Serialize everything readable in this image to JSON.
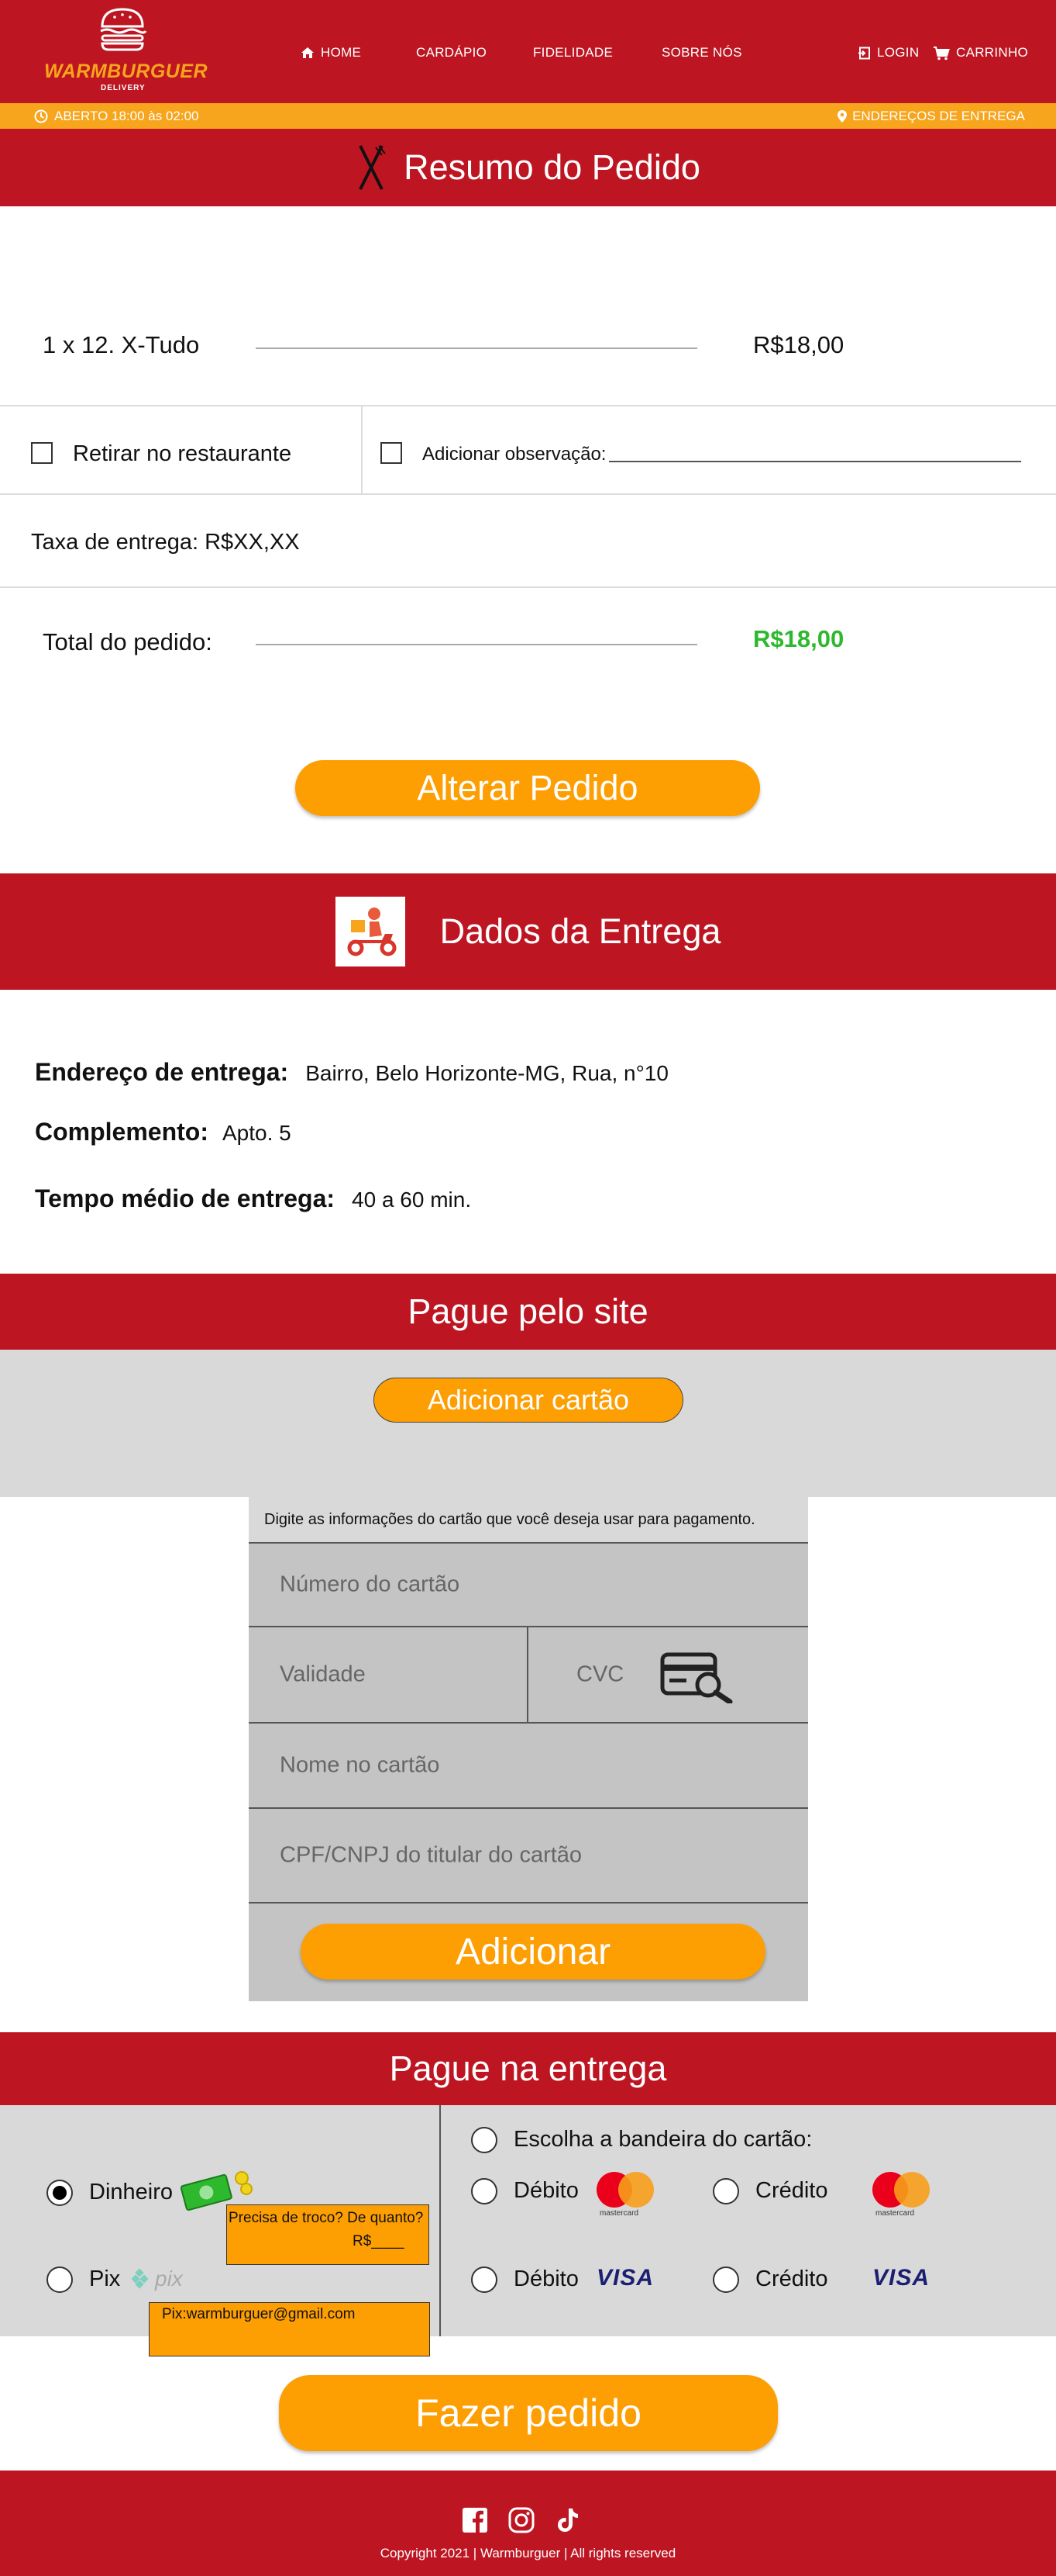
{
  "header": {
    "brand": "WARMBURGUER",
    "brand_sub": "DELIVERY",
    "nav": [
      {
        "label": "HOME",
        "icon": "home-icon"
      },
      {
        "label": "CARDÁPIO"
      },
      {
        "label": "FIDELIDADE"
      },
      {
        "label": "SOBRE NÓS"
      }
    ],
    "login": "LOGIN",
    "cart": "CARRINHO"
  },
  "status_bar": {
    "open_hours": "ABERTO 18:00 às 02:00",
    "delivery_addresses": "ENDEREÇOS DE ENTREGA"
  },
  "order_summary": {
    "title": "Resumo do Pedido",
    "item": "1 x 12. X-Tudo",
    "item_price": "R$18,00",
    "pickup_label": "Retirar no restaurante",
    "note_label": "Adicionar observação:",
    "delivery_fee": "Taxa de entrega: R$XX,XX",
    "total_label": "Total do pedido:",
    "total_value": "R$18,00",
    "change_order_button": "Alterar Pedido"
  },
  "delivery": {
    "title": "Dados da Entrega",
    "address_label": "Endereço de entrega:",
    "address_value": "Bairro, Belo Horizonte-MG, Rua, n°10",
    "complement_label": "Complemento:",
    "complement_value": "Apto. 5",
    "time_label": "Tempo médio de entrega:",
    "time_value": "40 a 60 min."
  },
  "pay_online": {
    "title": "Pague pelo site",
    "add_card_button": "Adicionar cartão",
    "card_form": {
      "instructions": "Digite as informações do cartão que você  deseja usar para pagamento.",
      "card_number_placeholder": "Número do cartão",
      "expiry_placeholder": "Validade",
      "cvc_placeholder": "CVC",
      "name_placeholder": "Nome no cartão",
      "document_placeholder": "CPF/CNPJ do titular do cartão",
      "submit_button": "Adicionar"
    }
  },
  "pay_on_delivery": {
    "title": "Pague na entrega",
    "cash_label": "Dinheiro",
    "change_question": "Precisa de troco? De quanto?",
    "change_amount": "R$____",
    "pix_label": "Pix",
    "pix_logo_text": "pix",
    "pix_key": "Pix:warmburguer@gmail.com",
    "card_brand_prompt": "Escolha a bandeira do cartão:",
    "debit_label": "Débito",
    "credit_label": "Crédito",
    "mastercard_text": "mastercard",
    "visa_text": "VISA",
    "place_order_button": "Fazer pedido"
  },
  "footer": {
    "social_icons": [
      "facebook-icon",
      "instagram-icon",
      "tiktok-icon"
    ],
    "copyright": "Copyright 2021 | Warmburguer | All rights reserved"
  },
  "colors": {
    "brand_red": "#bd1622",
    "accent_orange": "#fd9e03",
    "status_orange": "#f7a51c",
    "total_green": "#2eb82e",
    "gray_panel": "#d9d9d9",
    "form_gray": "#c4c4c4"
  }
}
